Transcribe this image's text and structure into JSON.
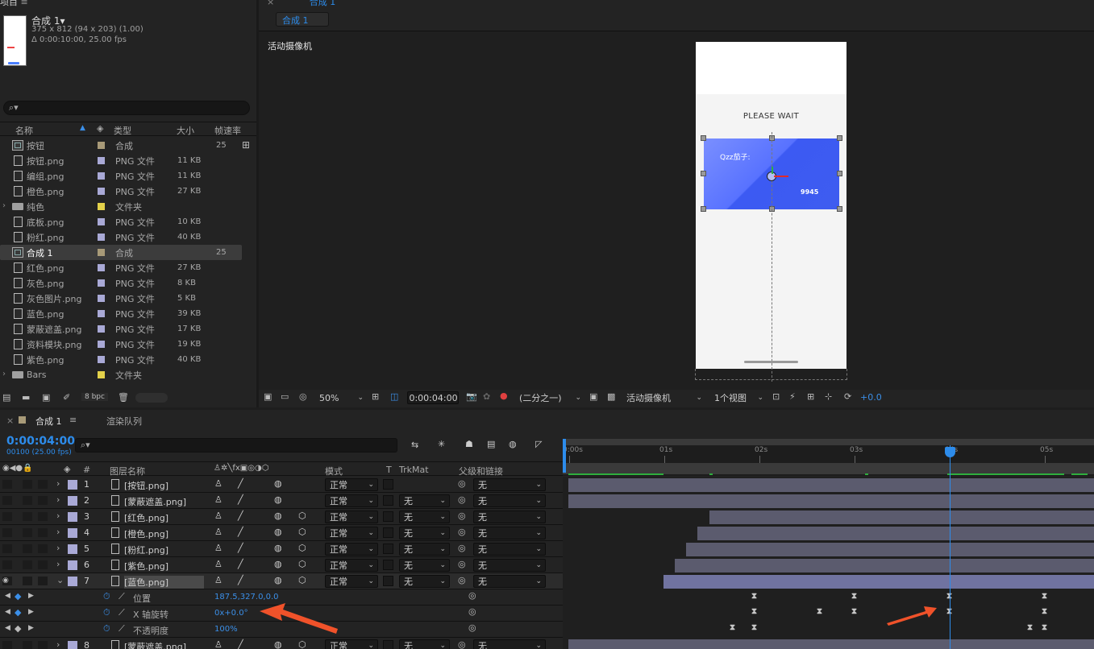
{
  "project": {
    "panel_title": "项目",
    "comp_name": "合成 1▾",
    "comp_size": "375 x 812  (94 x 203) (1.00)",
    "comp_duration": "Δ 0:00:10:00, 25.00 fps",
    "search_placeholder": "",
    "columns": {
      "name": "名称",
      "type": "类型",
      "size": "大小",
      "fps": "帧速率"
    },
    "items": [
      {
        "name": "按钮",
        "type": "合成",
        "size": "",
        "fps": "25",
        "icon": "comp-icon",
        "label_color": "#a89a78",
        "folder": false,
        "selected": false
      },
      {
        "name": "按钮.png",
        "type": "PNG 文件",
        "size": "11 KB",
        "fps": "",
        "icon": "png-file-icon",
        "label_color": "#a9a9d6",
        "folder": false,
        "selected": false
      },
      {
        "name": "编组.png",
        "type": "PNG 文件",
        "size": "11 KB",
        "fps": "",
        "icon": "png-file-icon",
        "label_color": "#a9a9d6",
        "folder": false,
        "selected": false
      },
      {
        "name": "橙色.png",
        "type": "PNG 文件",
        "size": "27 KB",
        "fps": "",
        "icon": "png-file-icon",
        "label_color": "#a9a9d6",
        "folder": false,
        "selected": false
      },
      {
        "name": "纯色",
        "type": "文件夹",
        "size": "",
        "fps": "",
        "icon": "folder-icon",
        "label_color": "#e3d14a",
        "folder": true,
        "selected": false
      },
      {
        "name": "底板.png",
        "type": "PNG 文件",
        "size": "10 KB",
        "fps": "",
        "icon": "png-file-icon",
        "label_color": "#a9a9d6",
        "folder": false,
        "selected": false
      },
      {
        "name": "粉红.png",
        "type": "PNG 文件",
        "size": "40 KB",
        "fps": "",
        "icon": "png-file-icon",
        "label_color": "#a9a9d6",
        "folder": false,
        "selected": false
      },
      {
        "name": "合成 1",
        "type": "合成",
        "size": "",
        "fps": "25",
        "icon": "comp-icon",
        "label_color": "#a89a78",
        "folder": false,
        "selected": true
      },
      {
        "name": "红色.png",
        "type": "PNG 文件",
        "size": "27 KB",
        "fps": "",
        "icon": "png-file-icon",
        "label_color": "#a9a9d6",
        "folder": false,
        "selected": false
      },
      {
        "name": "灰色.png",
        "type": "PNG 文件",
        "size": "8 KB",
        "fps": "",
        "icon": "png-file-icon",
        "label_color": "#a9a9d6",
        "folder": false,
        "selected": false
      },
      {
        "name": "灰色图片.png",
        "type": "PNG 文件",
        "size": "5 KB",
        "fps": "",
        "icon": "png-file-icon",
        "label_color": "#a9a9d6",
        "folder": false,
        "selected": false
      },
      {
        "name": "蓝色.png",
        "type": "PNG 文件",
        "size": "39 KB",
        "fps": "",
        "icon": "png-file-icon",
        "label_color": "#a9a9d6",
        "folder": false,
        "selected": false
      },
      {
        "name": "蒙蔽遮盖.png",
        "type": "PNG 文件",
        "size": "17 KB",
        "fps": "",
        "icon": "png-file-icon",
        "label_color": "#a9a9d6",
        "folder": false,
        "selected": false
      },
      {
        "name": "资料模块.png",
        "type": "PNG 文件",
        "size": "19 KB",
        "fps": "",
        "icon": "png-file-icon",
        "label_color": "#a9a9d6",
        "folder": false,
        "selected": false
      },
      {
        "name": "紫色.png",
        "type": "PNG 文件",
        "size": "40 KB",
        "fps": "",
        "icon": "png-file-icon",
        "label_color": "#a9a9d6",
        "folder": false,
        "selected": false
      },
      {
        "name": "Bars",
        "type": "文件夹",
        "size": "",
        "fps": "",
        "icon": "folder-icon",
        "label_color": "#e3d14a",
        "folder": true,
        "selected": false
      }
    ],
    "bpc": "8 bpc"
  },
  "viewer": {
    "header_title": "合成 1",
    "tab_label": "合成 1",
    "camera_label": "活动摄像机",
    "canvas": {
      "please_wait": "PLEASE WAIT",
      "card_title": "Qzz茄子:",
      "card_number": "9945",
      "card_color_start": "#6f86ff",
      "card_color_end": "#3d5bf2"
    },
    "zoom": "50%",
    "timecode": "0:00:04:00",
    "resolution": "(二分之一)",
    "camera_dropdown": "活动摄像机",
    "views": "1个视图",
    "exposure": "+0.0"
  },
  "timeline": {
    "tab_label": "合成 1",
    "render_queue": "渲染队列",
    "current_time": "0:00:04:00",
    "frame_info": "00100 (25.00 fps)",
    "col_num": "#",
    "col_layer_name": "图层名称",
    "col_mode": "模式",
    "col_t": "T",
    "col_trkmat": "TrkMat",
    "col_parent": "父级和链接",
    "ruler": [
      "0:00s",
      "01s",
      "02s",
      "03s",
      "04s",
      "05s"
    ],
    "accent": "#2d8ceb",
    "layers": [
      {
        "num": "1",
        "name": "[按钮.png]",
        "mode": "正常",
        "trkmat": "",
        "parent": "无",
        "visible": false
      },
      {
        "num": "2",
        "name": "[蒙蔽遮盖.png]",
        "mode": "正常",
        "trkmat": "无",
        "parent": "无",
        "visible": false
      },
      {
        "num": "3",
        "name": "[红色.png]",
        "mode": "正常",
        "trkmat": "无",
        "parent": "无",
        "visible": false
      },
      {
        "num": "4",
        "name": "[橙色.png]",
        "mode": "正常",
        "trkmat": "无",
        "parent": "无",
        "visible": false
      },
      {
        "num": "5",
        "name": "[粉红.png]",
        "mode": "正常",
        "trkmat": "无",
        "parent": "无",
        "visible": false
      },
      {
        "num": "6",
        "name": "[紫色.png]",
        "mode": "正常",
        "trkmat": "无",
        "parent": "无",
        "visible": false
      },
      {
        "num": "7",
        "name": "[蓝色.png]",
        "mode": "正常",
        "trkmat": "无",
        "parent": "无",
        "visible": true
      },
      {
        "num": "8",
        "name": "[蒙蔽遮盖.png]",
        "mode": "正常",
        "trkmat": "无",
        "parent": "无",
        "visible": false
      }
    ],
    "properties": [
      {
        "name": "位置",
        "value": "187.5,327.0,0.0"
      },
      {
        "name": "X 轴旋转",
        "value": "0x+0.0°"
      },
      {
        "name": "不透明度",
        "value": "100%"
      }
    ]
  }
}
